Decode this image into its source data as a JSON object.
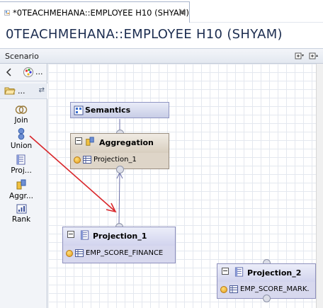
{
  "tab": {
    "title": "*0TEACHMEHANA::EMPLOYEE H10 (SHYAM)",
    "icon": "calculation-view-icon",
    "close_icon": "close-icon"
  },
  "editor": {
    "title": "0TEACHMEHANA::EMPLOYEE H10 (SHYAM)"
  },
  "scenario": {
    "label": "Scenario",
    "tools": [
      "expand-all-icon",
      "maximize-icon"
    ]
  },
  "palette": {
    "more": "...",
    "drawer_label": "...",
    "items": [
      {
        "label": "Join",
        "icon": "join-icon"
      },
      {
        "label": "Union",
        "icon": "union-icon"
      },
      {
        "label": "Proj...",
        "icon": "projection-icon"
      },
      {
        "label": "Aggr...",
        "icon": "aggregation-icon"
      },
      {
        "label": "Rank",
        "icon": "rank-icon"
      }
    ]
  },
  "nodes": {
    "semantics": {
      "title": "Semantics"
    },
    "aggregation": {
      "title": "Aggregation",
      "input": "Projection_1"
    },
    "projection_1": {
      "title": "Projection_1",
      "input": "EMP_SCORE_FINANCE"
    },
    "projection_2": {
      "title": "Projection_2",
      "input": "EMP_SCORE_MARK."
    }
  },
  "colors": {
    "annotation_arrow": "#d9262a",
    "edge": "#6b6fa8",
    "title_text": "#1c2d50"
  }
}
